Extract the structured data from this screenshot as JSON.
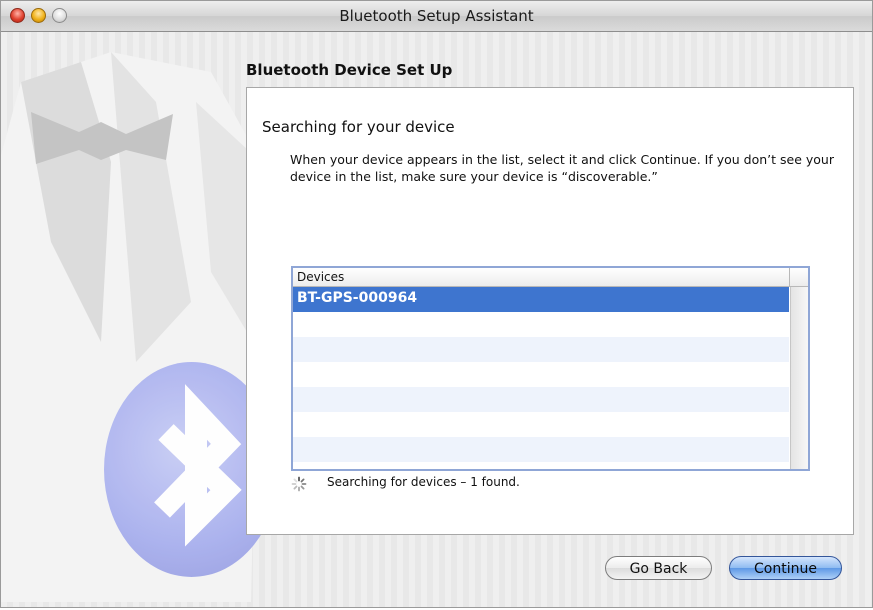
{
  "window": {
    "title": "Bluetooth Setup Assistant"
  },
  "section": {
    "title": "Bluetooth Device Set Up"
  },
  "panel": {
    "heading": "Searching for your device",
    "description": "When your device appears in the list, select it and click Continue. If you don’t see your device in the list, make sure your device is “discoverable.”"
  },
  "device_list": {
    "column_header": "Devices",
    "devices": [
      "BT-GPS-000964"
    ],
    "selected_index": 0
  },
  "status": {
    "text": "Searching for devices – 1 found."
  },
  "buttons": {
    "back_label": "Go Back",
    "continue_label": "Continue"
  },
  "icons": {
    "decorative_art": "bluetooth-logo-icon",
    "status": "spinner-icon"
  },
  "colors": {
    "selection": "#3e75cf",
    "default_button": "#5e98e6",
    "alternate_row": "#eef3fc"
  }
}
